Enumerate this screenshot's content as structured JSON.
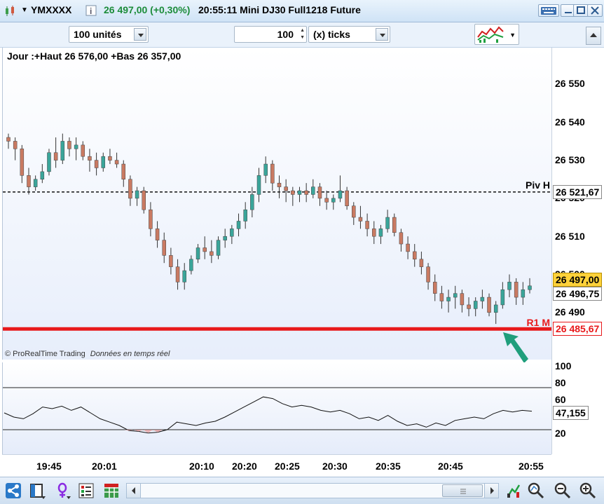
{
  "title_bar": {
    "symbol": "YMXXXX",
    "price": "26 497,00 (+0,30%)",
    "time_and_name": "20:55:11 Mini DJ30 Full1218 Future"
  },
  "toolbar": {
    "quantity": "100 unités",
    "ticks_value": "100",
    "ticks_unit": "(x) ticks"
  },
  "chart_info": {
    "day_info": "Jour :+Haut 26 576,00 +Bas 26 357,00",
    "copyright": "© ProRealTime Trading",
    "realtime": "Données en temps réel"
  },
  "price_axis": {
    "ticks": [
      "26 550",
      "26 540",
      "26 530",
      "26 520",
      "26 510",
      "26 500",
      "26 490"
    ],
    "piv_label": "Piv H",
    "piv_value": "26 521,67",
    "r1_label": "R1 M",
    "r1_value": "26 485,67",
    "last_price": "26 497,00",
    "current_price": "26 496,75"
  },
  "oscillator": {
    "ticks": [
      "100",
      "80",
      "60",
      "40",
      "20"
    ],
    "value": "47,155",
    "upper_level": 75,
    "lower_level": 25
  },
  "time_axis": {
    "labels": [
      "19:45",
      "20:01",
      "20:10",
      "20:20",
      "20:25",
      "20:30",
      "20:35",
      "20:45",
      "20:55"
    ]
  },
  "colors": {
    "up": "#3aa59a",
    "down": "#c97a62",
    "r1": "#e8191b",
    "arrow": "#1f9e7c",
    "last_price_bg": "#ffd23a"
  },
  "chart_data": {
    "type": "candlestick",
    "y_range": [
      26480,
      26555
    ],
    "pivot_line": 26521.67,
    "r1_line": 26485.67,
    "candles": [
      [
        26536,
        26537,
        26533,
        26535
      ],
      [
        26535,
        26536,
        26530,
        26533
      ],
      [
        26533,
        26534,
        26524,
        26526
      ],
      [
        26526,
        26528,
        26521,
        26523
      ],
      [
        26523,
        26526,
        26522,
        26525
      ],
      [
        26525,
        26529,
        26524,
        26527
      ],
      [
        26527,
        26533,
        26526,
        26532
      ],
      [
        26532,
        26536,
        26528,
        26530
      ],
      [
        26530,
        26537,
        26529,
        26535
      ],
      [
        26535,
        26536,
        26531,
        26533
      ],
      [
        26533,
        26536,
        26530,
        26534
      ],
      [
        26534,
        26535,
        26530,
        26531
      ],
      [
        26531,
        26533,
        26527,
        26530
      ],
      [
        26530,
        26532,
        26526,
        26528
      ],
      [
        26528,
        26532,
        26527,
        26531
      ],
      [
        26531,
        26533,
        26529,
        26530
      ],
      [
        26530,
        26532,
        26528,
        26529
      ],
      [
        26529,
        26530,
        26523,
        26525
      ],
      [
        26525,
        26526,
        26518,
        26520
      ],
      [
        26520,
        26523,
        26518,
        26522
      ],
      [
        26522,
        26523,
        26516,
        26517
      ],
      [
        26517,
        26519,
        26510,
        26512
      ],
      [
        26512,
        26514,
        26507,
        26509
      ],
      [
        26509,
        26511,
        26503,
        26505
      ],
      [
        26505,
        26507,
        26500,
        26502
      ],
      [
        26502,
        26504,
        26496,
        26498
      ],
      [
        26498,
        26503,
        26496,
        26501
      ],
      [
        26501,
        26505,
        26500,
        26504
      ],
      [
        26504,
        26508,
        26503,
        26507
      ],
      [
        26507,
        26510,
        26504,
        26506
      ],
      [
        26506,
        26509,
        26503,
        26505
      ],
      [
        26505,
        26510,
        26504,
        26509
      ],
      [
        26509,
        26512,
        26507,
        26510
      ],
      [
        26510,
        26513,
        26508,
        26512
      ],
      [
        26512,
        26516,
        26510,
        26514
      ],
      [
        26514,
        26519,
        26512,
        26517
      ],
      [
        26517,
        26523,
        26515,
        26521
      ],
      [
        26521,
        26528,
        26519,
        26526
      ],
      [
        26526,
        26531,
        26524,
        26529
      ],
      [
        26529,
        26530,
        26522,
        26524
      ],
      [
        26524,
        26526,
        26520,
        26523
      ],
      [
        26523,
        26525,
        26519,
        26522
      ],
      [
        26522,
        26523,
        26518,
        26521
      ],
      [
        26521,
        26523,
        26519,
        26522
      ],
      [
        26522,
        26524,
        26519,
        26521
      ],
      [
        26521,
        26525,
        26520,
        26523
      ],
      [
        26523,
        26524,
        26518,
        26520
      ],
      [
        26520,
        26522,
        26517,
        26519
      ],
      [
        26519,
        26521,
        26517,
        26520
      ],
      [
        26520,
        26526,
        26519,
        26522
      ],
      [
        26522,
        26523,
        26517,
        26518
      ],
      [
        26518,
        26519,
        26513,
        26515
      ],
      [
        26515,
        26518,
        26512,
        26514
      ],
      [
        26514,
        26516,
        26510,
        26512
      ],
      [
        26512,
        26514,
        26508,
        26510
      ],
      [
        26510,
        26513,
        26508,
        26512
      ],
      [
        26512,
        26517,
        26511,
        26515
      ],
      [
        26515,
        26516,
        26510,
        26511
      ],
      [
        26511,
        26512,
        26506,
        26508
      ],
      [
        26508,
        26510,
        26504,
        26506
      ],
      [
        26506,
        26508,
        26502,
        26504
      ],
      [
        26504,
        26506,
        26500,
        26502
      ],
      [
        26502,
        26503,
        26496,
        26498
      ],
      [
        26498,
        26500,
        26493,
        26495
      ],
      [
        26495,
        26497,
        26491,
        26493
      ],
      [
        26493,
        26496,
        26490,
        26494
      ],
      [
        26494,
        26497,
        26491,
        26495
      ],
      [
        26495,
        26496,
        26490,
        26492
      ],
      [
        26492,
        26494,
        26489,
        26491
      ],
      [
        26491,
        26494,
        26489,
        26493
      ],
      [
        26493,
        26496,
        26491,
        26494
      ],
      [
        26494,
        26495,
        26489,
        26490
      ],
      [
        26490,
        26493,
        26487,
        26492
      ],
      [
        26492,
        26498,
        26491,
        26496
      ],
      [
        26496,
        26500,
        26494,
        26498
      ],
      [
        26498,
        26499,
        26492,
        26494
      ],
      [
        26494,
        26498,
        26492,
        26496
      ],
      [
        26496,
        26499,
        26495,
        26497
      ]
    ],
    "oscillator_values": [
      45,
      40,
      38,
      44,
      52,
      50,
      53,
      48,
      52,
      45,
      38,
      34,
      30,
      24,
      23,
      21,
      22,
      25,
      34,
      32,
      30,
      33,
      35,
      40,
      46,
      52,
      58,
      64,
      62,
      56,
      52,
      54,
      52,
      48,
      46,
      48,
      44,
      38,
      40,
      36,
      42,
      35,
      30,
      32,
      28,
      33,
      30,
      36,
      38,
      40,
      38,
      44,
      48,
      46,
      48,
      47
    ]
  }
}
